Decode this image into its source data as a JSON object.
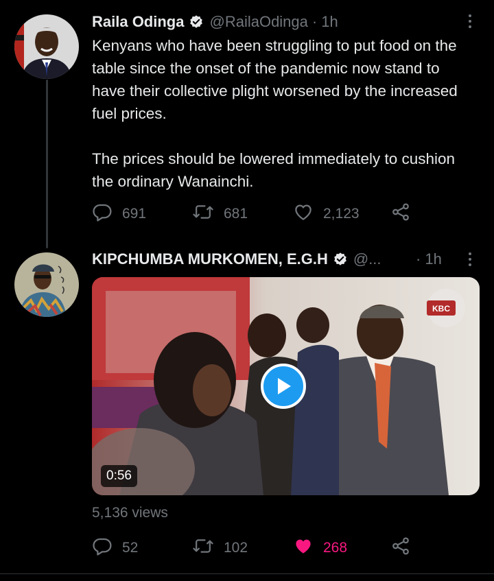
{
  "tweet1": {
    "name": "Raila Odinga",
    "handle": "@RailaOdinga",
    "dot": "·",
    "time": "1h",
    "text1": "Kenyans who have been struggling to put food on the table since the onset of the pandemic now stand to have their collective plight worsened by the increased fuel prices.",
    "text2": "The prices should be lowered immediately to cushion the ordinary Wanainchi.",
    "replies": "691",
    "retweets": "681",
    "likes": "2,123"
  },
  "tweet2": {
    "name": "KIPCHUMBA MURKOMEN, E.G.H",
    "handle": "@...",
    "dot": "·",
    "time": "1h",
    "video_duration": "0:56",
    "video_logo": "KBC",
    "views": "5,136 views",
    "replies": "52",
    "retweets": "102",
    "likes": "268",
    "liked": true
  },
  "colors": {
    "background": "#000000",
    "text": "#e7e9ea",
    "muted": "#71767b",
    "accent": "#1d9bf0",
    "like": "#f91880"
  },
  "icons": [
    "verified-badge-icon",
    "more-icon",
    "reply-icon",
    "retweet-icon",
    "like-icon",
    "share-icon",
    "play-icon"
  ]
}
